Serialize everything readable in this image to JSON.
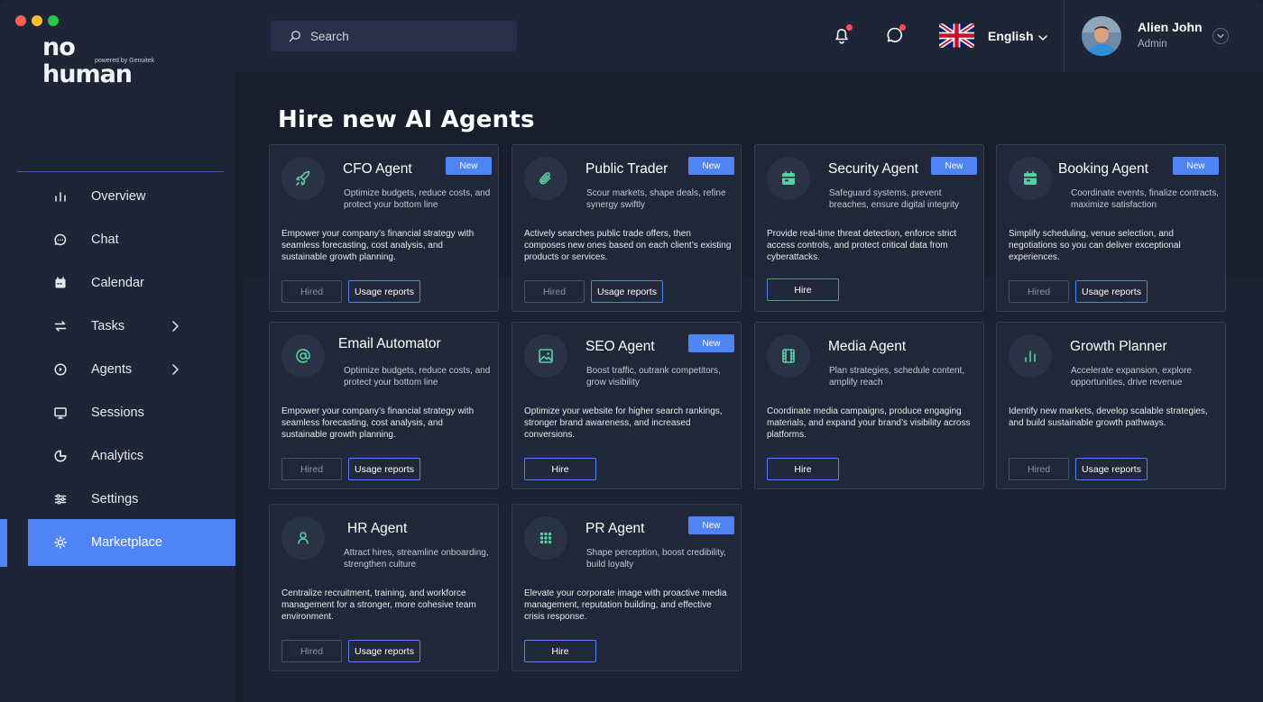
{
  "brand": {
    "logo_text": "no human",
    "tagline": "powered by Genuitek"
  },
  "colors": {
    "accent": "#4f84f6",
    "icon_green": "#58d0a0",
    "notification_dot": "#ff4a5a"
  },
  "header": {
    "search_placeholder": "Search",
    "language": "English",
    "user": {
      "name": "Alien John",
      "role": "Admin"
    }
  },
  "sidebar": {
    "items": [
      {
        "label": "Overview",
        "icon": "bar-chart-icon"
      },
      {
        "label": "Chat",
        "icon": "chat-bubble-icon"
      },
      {
        "label": "Calendar",
        "icon": "calendar-icon"
      },
      {
        "label": "Tasks",
        "icon": "swap-arrows-icon",
        "has_submenu": true
      },
      {
        "label": "Agents",
        "icon": "play-circle-icon",
        "has_submenu": true
      },
      {
        "label": "Sessions",
        "icon": "monitor-icon"
      },
      {
        "label": "Analytics",
        "icon": "pie-chart-icon"
      },
      {
        "label": "Settings",
        "icon": "sliders-icon"
      },
      {
        "label": "Marketplace",
        "icon": "sun-icon",
        "active": true
      }
    ]
  },
  "main": {
    "title": "Hire new AI Agents",
    "cards": [
      {
        "title": "CFO Agent",
        "badge": "New",
        "icon": "rocket-icon",
        "subtitle": "Optimize budgets, reduce costs, and protect your bottom line",
        "description": "Empower your company’s financial strategy with seamless forecasting, cost analysis, and sustainable growth planning.",
        "hired_label": "Hired",
        "usage_label": "Usage reports"
      },
      {
        "title": "Public Trader",
        "badge": "New",
        "icon": "paperclip-icon",
        "subtitle": "Scour markets, shape deals, refine synergy swiftly",
        "description": "Actively searches public trade offers, then composes new ones based on each client’s existing products or services.",
        "hired_label": "Hired",
        "usage_label": "Usage reports"
      },
      {
        "title": "Security Agent",
        "badge": "New",
        "icon": "calendar-card-icon",
        "subtitle": "Safeguard systems, prevent breaches, ensure digital integrity",
        "description": "Provide real-time threat detection, enforce strict access controls, and protect critical data from cyberattacks.",
        "hire_label": "Hire"
      },
      {
        "title": "Booking Agent",
        "badge": "New",
        "icon": "calendar-card-icon",
        "subtitle": "Coordinate events, finalize contracts, maximize satisfaction",
        "description": "Simplify scheduling, venue selection, and negotiations so you can deliver exceptional experiences.",
        "hired_label": "Hired",
        "usage_label": "Usage reports"
      },
      {
        "title": "Email Automator",
        "icon": "at-sign-icon",
        "subtitle": "Optimize budgets, reduce costs, and protect your bottom line",
        "description": "Empower your company’s financial strategy with seamless forecasting, cost analysis, and sustainable growth planning.",
        "hired_label": "Hired",
        "usage_label": "Usage reports"
      },
      {
        "title": "SEO Agent",
        "badge": "New",
        "icon": "image-icon",
        "subtitle": "Boost traffic, outrank competitors, grow visibility",
        "description": "Optimize your website for higher search rankings, stronger brand awareness, and increased conversions.",
        "hire_label": "Hire"
      },
      {
        "title": "Media Agent",
        "icon": "film-icon",
        "subtitle": "Plan strategies, schedule content, amplify reach",
        "description": "Coordinate media campaigns, produce engaging materials, and expand your brand’s visibility across platforms.",
        "hire_label": "Hire"
      },
      {
        "title": "Growth Planner",
        "icon": "bar-chart-icon",
        "subtitle": "Accelerate expansion, explore opportunities, drive revenue",
        "description": "Identify new markets, develop scalable strategies, and build sustainable growth pathways.",
        "hired_label": "Hired",
        "usage_label": "Usage reports"
      },
      {
        "title": "HR Agent",
        "icon": "user-icon",
        "subtitle": "Attract hires, streamline onboarding, strengthen culture",
        "description": "Centralize recruitment, training, and workforce management for a stronger, more cohesive team environment.",
        "hired_label": "Hired",
        "usage_label": "Usage reports"
      },
      {
        "title": "PR Agent",
        "badge": "New",
        "icon": "grid-dots-icon",
        "subtitle": "Shape perception, boost credibility, build loyalty",
        "description": "Elevate your corporate image with proactive media management, reputation building, and effective crisis response.",
        "hire_label": "Hire"
      }
    ]
  }
}
